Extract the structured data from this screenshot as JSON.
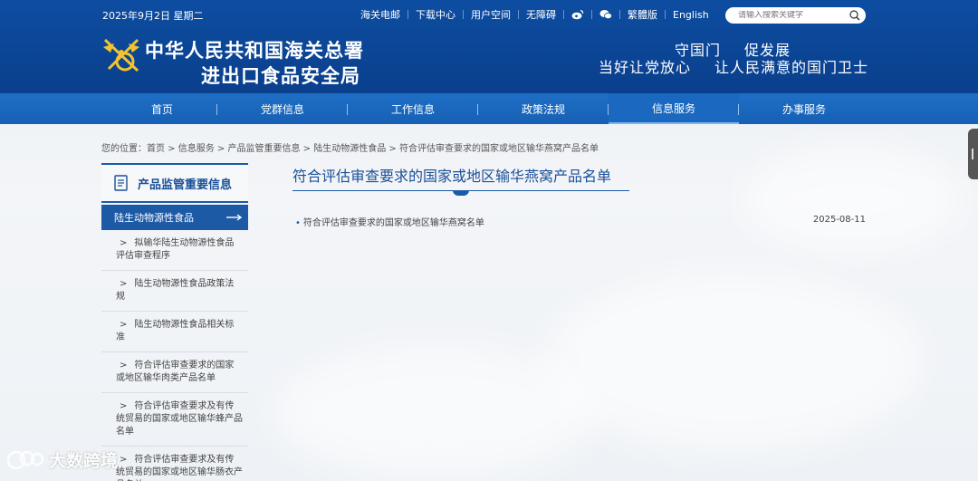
{
  "header": {
    "date": "2025年9月2日 星期二",
    "links": [
      "海关电邮",
      "下载中心",
      "用户空间",
      "无障碍"
    ],
    "lang_links": [
      "繁體版",
      "English"
    ],
    "search_placeholder": "请输入搜索关键字",
    "org_line1": "中华人民共和国海关总署",
    "org_line2": "进出口食品安全局",
    "slogan1_a": "守国门",
    "slogan1_b": "促发展",
    "slogan2_a": "当好让党放心",
    "slogan2_b": "让人民满意的国门卫士",
    "colors": {
      "header_bg": "#0d4da1",
      "nav_bg": "#1660b4"
    }
  },
  "nav": {
    "items": [
      "首页",
      "党群信息",
      "工作信息",
      "政策法规",
      "信息服务",
      "办事服务"
    ],
    "active": "信息服务"
  },
  "breadcrumb": "您的位置：首页 > 信息服务 > 产品监管重要信息 > 陆生动物源性食品 > 符合评估审查要求的国家或地区输华燕窝产品名单",
  "sidebar": {
    "title": "产品监管重要信息",
    "category": "陆生动物源性食品",
    "items": [
      "拟输华陆生动物源性食品评估审查程序",
      "陆生动物源性食品政策法规",
      "陆生动物源性食品相关标准",
      "符合评估审查要求的国家或地区输华肉类产品名单",
      "符合评估审查要求及有传统贸易的国家或地区输华蜂产品名单",
      "符合评估审查要求及有传统贸易的国家或地区输华肠衣产品名单"
    ]
  },
  "main": {
    "title": "符合评估审查要求的国家或地区输华燕窝产品名单",
    "articles": [
      {
        "title": "符合评估审查要求的国家或地区输华燕窝名单",
        "date": "2025-08-11"
      }
    ]
  },
  "watermark": {
    "text": "大数跨境"
  }
}
